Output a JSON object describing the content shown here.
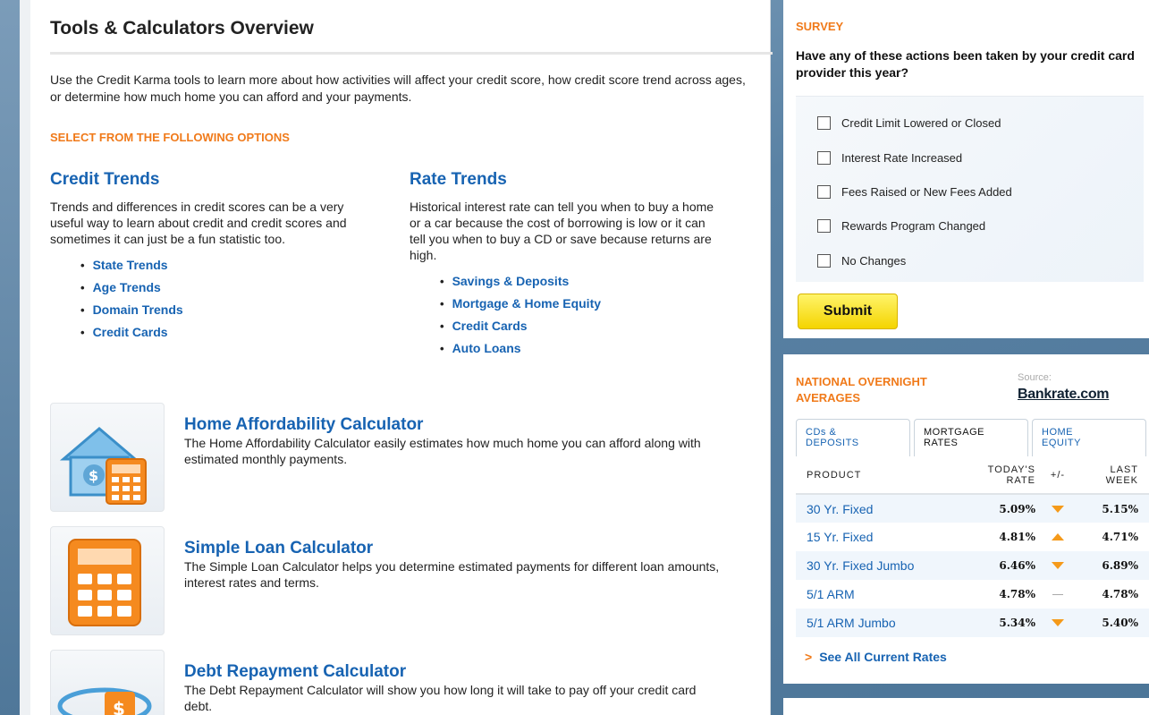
{
  "page": {
    "title": "Tools & Calculators Overview",
    "intro": "Use the Credit Karma tools to learn more about how activities will affect your credit score, how credit score trend across ages, or determine how much home you can afford and your payments.",
    "select_heading": "SELECT FROM THE FOLLOWING OPTIONS"
  },
  "credit_trends": {
    "title": "Credit Trends",
    "description": "Trends and differences in credit scores can be a very useful way to learn about credit and credit scores and sometimes it can just be a fun statistic too.",
    "links": [
      "State Trends",
      "Age Trends",
      "Domain Trends",
      "Credit Cards"
    ]
  },
  "rate_trends": {
    "title": "Rate Trends",
    "description": "Historical interest rate can tell you when to buy a home or a car because the cost of borrowing is low or it can tell you when to buy a CD or save because returns are high.",
    "links": [
      "Savings & Deposits",
      "Mortgage & Home Equity",
      "Credit Cards",
      "Auto Loans"
    ]
  },
  "calculators": [
    {
      "title": "Home Affordability Calculator",
      "description": "The Home Affordability Calculator easily estimates how much home you can afford along with estimated monthly payments."
    },
    {
      "title": "Simple Loan Calculator",
      "description": "The Simple Loan Calculator helps you determine estimated payments for different loan amounts, interest rates and terms."
    },
    {
      "title": "Debt Repayment Calculator",
      "description": "The Debt Repayment Calculator will show you how long it will take to pay off your credit card debt."
    }
  ],
  "survey": {
    "title": "SURVEY",
    "question": "Have any of these actions been taken by your credit card provider this year?",
    "options": [
      "Credit Limit Lowered or Closed",
      "Interest Rate Increased",
      "Fees Raised or New Fees Added",
      "Rewards Program Changed",
      "No Changes"
    ],
    "submit_label": "Submit"
  },
  "rates": {
    "title": "NATIONAL OVERNIGHT AVERAGES",
    "source_label": "Source:",
    "source_name": "Bankrate.com",
    "tabs": [
      {
        "line1": "CDs &",
        "line2": "DEPOSITS"
      },
      {
        "line1": "MORTGAGE",
        "line2": "RATES"
      },
      {
        "line1": "HOME",
        "line2": "EQUITY"
      }
    ],
    "columns": {
      "product": "PRODUCT",
      "today_1": "TODAY'S",
      "today_2": "RATE",
      "change": "+/-",
      "last_1": "LAST",
      "last_2": "WEEK"
    },
    "rows": [
      {
        "product": "30 Yr. Fixed",
        "today": "5.09%",
        "trend": "down",
        "last": "5.15%"
      },
      {
        "product": "15 Yr. Fixed",
        "today": "4.81%",
        "trend": "up",
        "last": "4.71%"
      },
      {
        "product": "30 Yr. Fixed Jumbo",
        "today": "6.46%",
        "trend": "down",
        "last": "6.89%"
      },
      {
        "product": "5/1 ARM",
        "today": "4.78%",
        "trend": "flat",
        "last": "4.78%"
      },
      {
        "product": "5/1 ARM Jumbo",
        "today": "5.34%",
        "trend": "down",
        "last": "5.40%"
      }
    ],
    "see_all": "See All Current Rates"
  },
  "colors": {
    "accent_orange": "#f07a1a",
    "link_blue": "#1763b2",
    "submit_yellow": "#f4d400"
  }
}
